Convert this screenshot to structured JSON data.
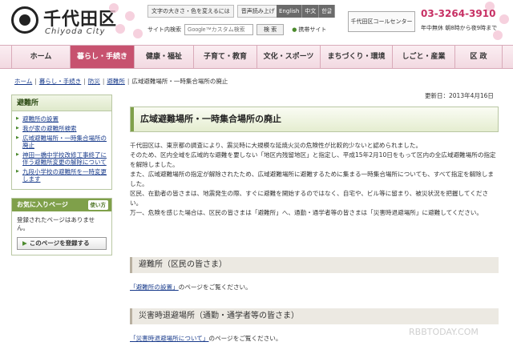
{
  "header": {
    "logo_title": "千代田区",
    "logo_sub": "Chiyoda City",
    "util_text_size": "文字の大きさ・色を変えるには",
    "util_voice": "音声読み上げ",
    "lang": [
      "English",
      "中文",
      "한글"
    ],
    "search_label": "サイト内検索",
    "search_placeholder": "Google™カスタム検索",
    "search_button": "検 索",
    "mobile_link": "携帯サイト",
    "callcenter": "千代田区コールセンター",
    "phone": "03-3264-3910",
    "phone_note": "年中無休 朝8時から夜9時まで"
  },
  "nav": {
    "items": [
      "ホーム",
      "暮らし・手続き",
      "健康・福祉",
      "子育て・教育",
      "文化・スポーツ",
      "まちづくり・環境",
      "しごと・産業",
      "区 政"
    ],
    "active_index": 1
  },
  "breadcrumb": [
    "ホーム",
    "暮らし・手続き",
    "防災",
    "避難所",
    "広域避難場所・一時集合場所の廃止"
  ],
  "sidebar": {
    "heading": "避難所",
    "items": [
      "避難所の設置",
      "我が家の避難所検索",
      "広域避難場所・一時集合場所の廃止",
      "神田一橋中学校改修工事終了に伴う避難所変更の解除について",
      "九段小学校の避難所を一時変更します"
    ],
    "fav_heading": "お気に入りページ",
    "fav_help": "使い方",
    "fav_text": "登録されたページはありません。",
    "fav_button": "このページを登録する"
  },
  "main": {
    "updated": "更新日：2013年4月16日",
    "title": "広域避難場所・一時集合場所の廃止",
    "paragraphs": [
      "千代田区は、東京都の調査により、震災時に大規模な延焼火災の危険性が比較的少ないと認められました。",
      "そのため、区内全域を広域的な避難を要しない「地区内残留地区」と指定し、平成15年2月10日をもって区内の全広域避難場所の指定を解除しました。",
      "また、広域避難場所の指定が解除されたため、広域避難場所に避難するために集まる一時集合場所についても、すべて指定を解除しました。",
      "区民、在勤者の皆さまは、地震発生の際、すぐに避難を開始するのではなく、自宅や、ビル等に留まり、被災状況を把握してください。",
      "万一、危険を感じた場合は、区民の皆さまは「避難所」へ、通勤・通学者等の皆さまは「災害時退避場所」に避難してください。"
    ],
    "section1_head": "避難所（区民の皆さま）",
    "section1_link": "「避難所の設置」",
    "section1_tail": "のページをご覧ください。",
    "section2_head": "災害時退避場所（通勤・通学者等の皆さま）",
    "section2_link": "「災害時退避場所について」",
    "section2_tail": "のページをご覧ください。"
  },
  "watermark": "RBBTODAY.COM",
  "colors": {
    "nav_active": "#c7526f",
    "sidebar_green": "#7fa04a",
    "phone": "#c73064"
  }
}
